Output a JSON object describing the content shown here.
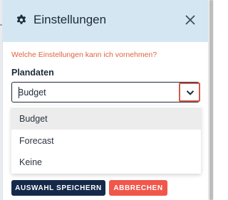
{
  "dialog": {
    "title": "Einstellungen",
    "icons": {
      "header": "gear-icon",
      "close": "close-icon",
      "toggle": "chevron-down-icon"
    }
  },
  "form": {
    "question": "Welche Einstellungen kann ich vornehmen?",
    "field_label": "Plandaten",
    "selected_value": "Budget",
    "options": [
      "Budget",
      "Forecast",
      "Keine"
    ],
    "highlighted_option": "Budget"
  },
  "buttons": {
    "save": "AUSWAHL SPEICHERN",
    "cancel": "ABBRECHEN"
  },
  "colors": {
    "header_bg": "#d3e6f2",
    "accent_orange": "#e0623d",
    "save_bg": "#15294a",
    "cancel_bg": "#f0574a",
    "toggle_border": "#d0594a"
  }
}
